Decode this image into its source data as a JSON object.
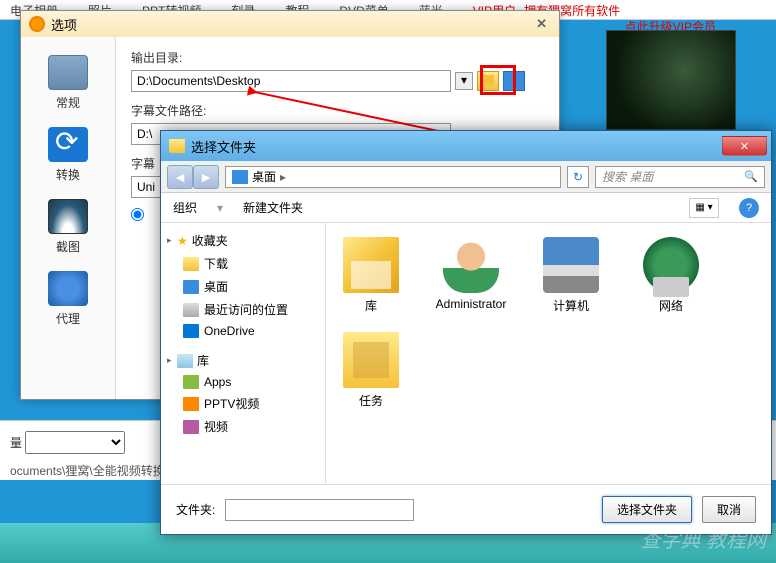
{
  "bg": {
    "links": [
      "电子相册",
      "照片",
      "PPT转视频",
      "刻录",
      "教程",
      "DVD菜单",
      "蓝光"
    ],
    "vip_text": "VIP用户--拥有狸窝所有软件",
    "vip_link": "点此升级VIP会员",
    "quality_label": "量",
    "output_path": "ocuments\\狸窝\\全能视频转换器"
  },
  "options": {
    "title": "选项",
    "sidebar": [
      {
        "label": "常规"
      },
      {
        "label": "转换"
      },
      {
        "label": "截图"
      },
      {
        "label": "代理"
      }
    ],
    "output_dir_label": "输出目录:",
    "output_dir_value": "D:\\Documents\\Desktop",
    "subtitle_path_label": "字幕文件路径:",
    "subtitle_path_value": "D:\\",
    "subtitle_enc_label": "字幕",
    "subtitle_enc_value": "Uni",
    "radio1": ""
  },
  "picker": {
    "title": "选择文件夹",
    "breadcrumb": "桌面",
    "search_placeholder": "搜索 桌面",
    "toolbar_organize": "组织",
    "toolbar_newfolder": "新建文件夹",
    "tree": {
      "favorites": "收藏夹",
      "fav_items": [
        "下载",
        "桌面",
        "最近访问的位置",
        "OneDrive"
      ],
      "library": "库",
      "lib_items": [
        "Apps",
        "PPTV视频",
        "视频"
      ]
    },
    "items": [
      {
        "name": "库",
        "icon": "big-library"
      },
      {
        "name": "Administrator",
        "icon": "big-user"
      },
      {
        "name": "计算机",
        "icon": "big-computer"
      },
      {
        "name": "网络",
        "icon": "big-network"
      },
      {
        "name": "任务",
        "icon": "big-task"
      }
    ],
    "footer_label": "文件夹:",
    "footer_value": "",
    "btn_select": "选择文件夹",
    "btn_cancel": "取消"
  },
  "watermark": "查字典 教程网"
}
